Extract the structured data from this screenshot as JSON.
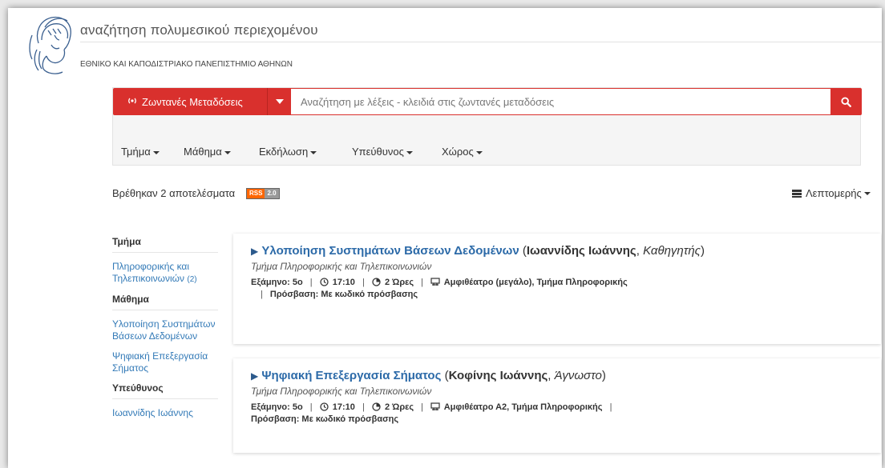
{
  "header": {
    "site_title": "αναζήτηση πολυμεσικού περιεχομένου",
    "university": "ΕΘΝΙΚΟ ΚΑΙ ΚΑΠΟΔΙΣΤΡΙΑΚΟ ΠΑΝΕΠΙΣΤΗΜΙΟ ΑΘΗΝΩΝ",
    "logo_icon": "university-athena-logo"
  },
  "search": {
    "mode_label": "Ζωντανές Μεταδόσεις",
    "mode_icon": "broadcast-icon",
    "placeholder": "Αναζήτηση με λέξεις - κλειδιά στις ζωντανές μεταδόσεις",
    "value": "",
    "button_icon": "search-icon",
    "accent_color": "#d9302d"
  },
  "filters": [
    {
      "label": "Τμήμα"
    },
    {
      "label": "Μάθημα"
    },
    {
      "label": "Εκδήλωση"
    },
    {
      "label": "Υπεύθυνος"
    },
    {
      "label": "Χώρος"
    }
  ],
  "results": {
    "count_text": "Βρέθηκαν 2 αποτελέσματα",
    "rss_label": "RSS",
    "rss_version": "2.0",
    "view_label": "Λεπτομερής"
  },
  "sidebar": {
    "dept_heading": "Τμήμα",
    "dept_items": [
      {
        "label": "Πληροφορικής και Τηλεπικοινωνιών",
        "count": "(2)"
      }
    ],
    "course_heading": "Μάθημα",
    "course_items": [
      {
        "label": "Υλοποίηση Συστημάτων Βάσεων Δεδομένων"
      },
      {
        "label": "Ψηφιακή Επεξεργασία Σήματος"
      }
    ],
    "instructor_heading": "Υπεύθυνος",
    "instructor_items": [
      {
        "label": "Ιωαννίδης Ιωάννης"
      }
    ]
  },
  "cards": [
    {
      "title": "Υλοποίηση Συστημάτων Βάσεων Δεδομένων",
      "instructor": "Ιωαννίδης Ιωάννης",
      "role": "Καθηγητής",
      "department": "Τμήμα Πληροφορικής και Τηλεπικοινωνιών",
      "semester": "Εξάμηνο: 5ο",
      "time": "17:10",
      "duration": "2 Ώρες",
      "room": "Αμφιθέατρο (μεγάλο), Τμήμα Πληροφορικής",
      "access": "Πρόσβαση: Με κωδικό πρόσβασης"
    },
    {
      "title": "Ψηφιακή Επεξεργασία Σήματος",
      "instructor": "Κοφίνης Ιωάννης",
      "role": "Άγνωστο",
      "department": "Τμήμα Πληροφορικής και Τηλεπικοινωνιών",
      "semester": "Εξάμηνο: 5ο",
      "time": "17:10",
      "duration": "2 Ώρες",
      "room": "Αμφιθέατρο Α2, Τμήμα Πληροφορικής",
      "access": "Πρόσβαση: Με κωδικό πρόσβασης"
    }
  ]
}
